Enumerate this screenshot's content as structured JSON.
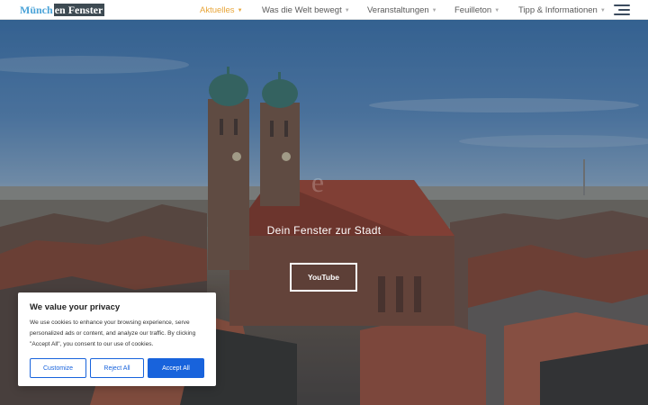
{
  "header": {
    "logo_part1": "Münch",
    "logo_part2": "en Fenster",
    "nav": [
      {
        "label": "Aktuelles",
        "active": true
      },
      {
        "label": "Was die Welt bewegt"
      },
      {
        "label": "Veranstaltungen"
      },
      {
        "label": "Feuilleton"
      },
      {
        "label": "Tipp & Informationen"
      }
    ],
    "menu_icon": "hamburger-menu-icon"
  },
  "hero": {
    "ghost_title": "e",
    "tagline": "Dein Fenster zur Stadt",
    "button_label": "YouTube"
  },
  "cookie": {
    "title": "We value your privacy",
    "text": "We use cookies to enhance your browsing experience, serve personalized ads or content, and analyze our traffic. By clicking \"Accept All\", you consent to our use of cookies.",
    "customize_label": "Customize",
    "reject_label": "Reject All",
    "accept_label": "Accept All"
  },
  "colors": {
    "nav_active": "#e8a63a",
    "logo_accent": "#4aa3d8",
    "cookie_button": "#1863dc"
  }
}
